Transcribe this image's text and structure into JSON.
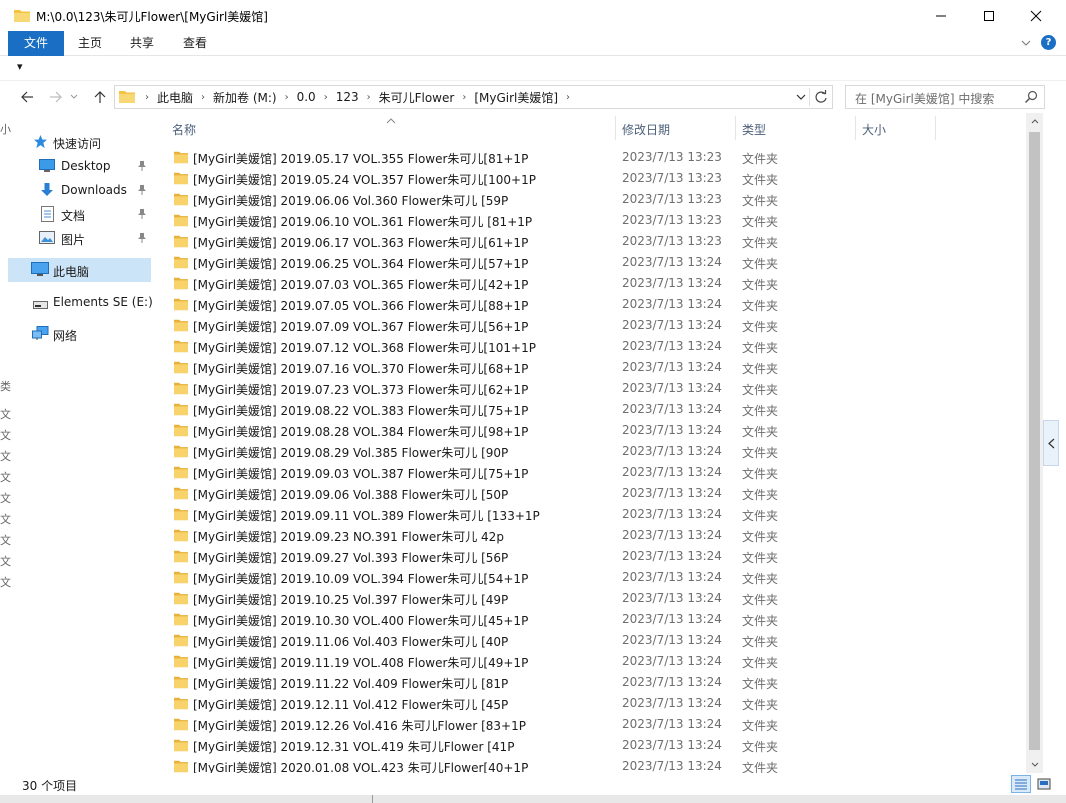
{
  "window": {
    "title": "M:\\0.0\\123\\朱可儿Flower\\[MyGirl美媛馆]",
    "minimize_label": "—",
    "maximize_label": "☐",
    "close_label": "✕"
  },
  "ribbon": {
    "tabs": [
      "文件",
      "主页",
      "共享",
      "查看"
    ],
    "help_label": "?"
  },
  "qat": {
    "dropdown_label": "▾"
  },
  "address": {
    "crumbs": [
      "此电脑",
      "新加卷 (M:)",
      "0.0",
      "123",
      "朱可儿Flower",
      "[MyGirl美媛馆]"
    ]
  },
  "search": {
    "placeholder": "在 [MyGirl美媛馆] 中搜索"
  },
  "nav": {
    "items": [
      {
        "label": "快速访问",
        "icon": "star-icon"
      },
      {
        "label": "Desktop",
        "icon": "desktop-icon",
        "pinned": true
      },
      {
        "label": "Downloads",
        "icon": "download-icon",
        "pinned": true
      },
      {
        "label": "文档",
        "icon": "document-icon",
        "pinned": true
      },
      {
        "label": "图片",
        "icon": "picture-icon",
        "pinned": true
      },
      {
        "label": "此电脑",
        "icon": "computer-icon",
        "selected": true
      },
      {
        "label": "Elements SE (E:)",
        "icon": "drive-icon"
      },
      {
        "label": "网络",
        "icon": "network-icon"
      }
    ],
    "left_edge_chars": [
      "小",
      "类",
      "文",
      "文",
      "文",
      "文",
      "文",
      "文",
      "文",
      "文",
      "文",
      "文"
    ]
  },
  "columns": {
    "name": "名称",
    "date": "修改日期",
    "type": "类型",
    "size": "大小"
  },
  "files": [
    {
      "name": "[MyGirl美媛馆] 2019.05.17 VOL.355 Flower朱可儿[81+1P",
      "date": "2023/7/13 13:23",
      "type": "文件夹"
    },
    {
      "name": "[MyGirl美媛馆] 2019.05.24 VOL.357 Flower朱可儿[100+1P",
      "date": "2023/7/13 13:23",
      "type": "文件夹"
    },
    {
      "name": "[MyGirl美媛馆] 2019.06.06 Vol.360 Flower朱可儿 [59P",
      "date": "2023/7/13 13:23",
      "type": "文件夹"
    },
    {
      "name": "[MyGirl美媛馆] 2019.06.10 VOL.361 Flower朱可儿 [81+1P",
      "date": "2023/7/13 13:23",
      "type": "文件夹"
    },
    {
      "name": "[MyGirl美媛馆] 2019.06.17 VOL.363 Flower朱可儿[61+1P",
      "date": "2023/7/13 13:23",
      "type": "文件夹"
    },
    {
      "name": "[MyGirl美媛馆] 2019.06.25 VOL.364 Flower朱可儿[57+1P",
      "date": "2023/7/13 13:24",
      "type": "文件夹"
    },
    {
      "name": "[MyGirl美媛馆] 2019.07.03 VOL.365 Flower朱可儿[42+1P",
      "date": "2023/7/13 13:24",
      "type": "文件夹"
    },
    {
      "name": "[MyGirl美媛馆] 2019.07.05 VOL.366 Flower朱可儿[88+1P",
      "date": "2023/7/13 13:24",
      "type": "文件夹"
    },
    {
      "name": "[MyGirl美媛馆] 2019.07.09 VOL.367 Flower朱可儿[56+1P",
      "date": "2023/7/13 13:24",
      "type": "文件夹"
    },
    {
      "name": "[MyGirl美媛馆] 2019.07.12 VOL.368 Flower朱可儿[101+1P",
      "date": "2023/7/13 13:24",
      "type": "文件夹"
    },
    {
      "name": "[MyGirl美媛馆] 2019.07.16 VOL.370 Flower朱可儿[68+1P",
      "date": "2023/7/13 13:24",
      "type": "文件夹"
    },
    {
      "name": "[MyGirl美媛馆] 2019.07.23 VOL.373 Flower朱可儿[62+1P",
      "date": "2023/7/13 13:24",
      "type": "文件夹"
    },
    {
      "name": "[MyGirl美媛馆] 2019.08.22 VOL.383 Flower朱可儿[75+1P",
      "date": "2023/7/13 13:24",
      "type": "文件夹"
    },
    {
      "name": "[MyGirl美媛馆] 2019.08.28 VOL.384 Flower朱可儿[98+1P",
      "date": "2023/7/13 13:24",
      "type": "文件夹"
    },
    {
      "name": "[MyGirl美媛馆] 2019.08.29 Vol.385 Flower朱可儿 [90P",
      "date": "2023/7/13 13:24",
      "type": "文件夹"
    },
    {
      "name": "[MyGirl美媛馆] 2019.09.03 VOL.387 Flower朱可儿[75+1P",
      "date": "2023/7/13 13:24",
      "type": "文件夹"
    },
    {
      "name": "[MyGirl美媛馆] 2019.09.06 Vol.388 Flower朱可儿 [50P",
      "date": "2023/7/13 13:24",
      "type": "文件夹"
    },
    {
      "name": "[MyGirl美媛馆] 2019.09.11 VOL.389 Flower朱可儿 [133+1P",
      "date": "2023/7/13 13:24",
      "type": "文件夹"
    },
    {
      "name": "[MyGirl美媛馆] 2019.09.23 NO.391 Flower朱可儿 42p",
      "date": "2023/7/13 13:24",
      "type": "文件夹"
    },
    {
      "name": "[MyGirl美媛馆] 2019.09.27 Vol.393 Flower朱可儿 [56P",
      "date": "2023/7/13 13:24",
      "type": "文件夹"
    },
    {
      "name": "[MyGirl美媛馆] 2019.10.09 VOL.394 Flower朱可儿[54+1P",
      "date": "2023/7/13 13:24",
      "type": "文件夹"
    },
    {
      "name": "[MyGirl美媛馆] 2019.10.25 Vol.397 Flower朱可儿 [49P",
      "date": "2023/7/13 13:24",
      "type": "文件夹"
    },
    {
      "name": "[MyGirl美媛馆] 2019.10.30 VOL.400 Flower朱可儿[45+1P",
      "date": "2023/7/13 13:24",
      "type": "文件夹"
    },
    {
      "name": "[MyGirl美媛馆] 2019.11.06 Vol.403 Flower朱可儿 [40P",
      "date": "2023/7/13 13:24",
      "type": "文件夹"
    },
    {
      "name": "[MyGirl美媛馆] 2019.11.19 VOL.408 Flower朱可儿[49+1P",
      "date": "2023/7/13 13:24",
      "type": "文件夹"
    },
    {
      "name": "[MyGirl美媛馆] 2019.11.22 Vol.409 Flower朱可儿 [81P",
      "date": "2023/7/13 13:24",
      "type": "文件夹"
    },
    {
      "name": "[MyGirl美媛馆] 2019.12.11 Vol.412 Flower朱可儿 [45P",
      "date": "2023/7/13 13:24",
      "type": "文件夹"
    },
    {
      "name": "[MyGirl美媛馆] 2019.12.26 Vol.416 朱可儿Flower [83+1P",
      "date": "2023/7/13 13:24",
      "type": "文件夹"
    },
    {
      "name": "[MyGirl美媛馆] 2019.12.31 VOL.419 朱可儿Flower [41P",
      "date": "2023/7/13 13:24",
      "type": "文件夹"
    },
    {
      "name": "[MyGirl美媛馆] 2020.01.08 VOL.423 朱可儿Flower[40+1P",
      "date": "2023/7/13 13:24",
      "type": "文件夹"
    }
  ],
  "status": {
    "item_count": "30 个项目"
  },
  "colors": {
    "accent": "#1a6fc4",
    "folder": "#f5c342",
    "selection": "#cce4f7"
  }
}
